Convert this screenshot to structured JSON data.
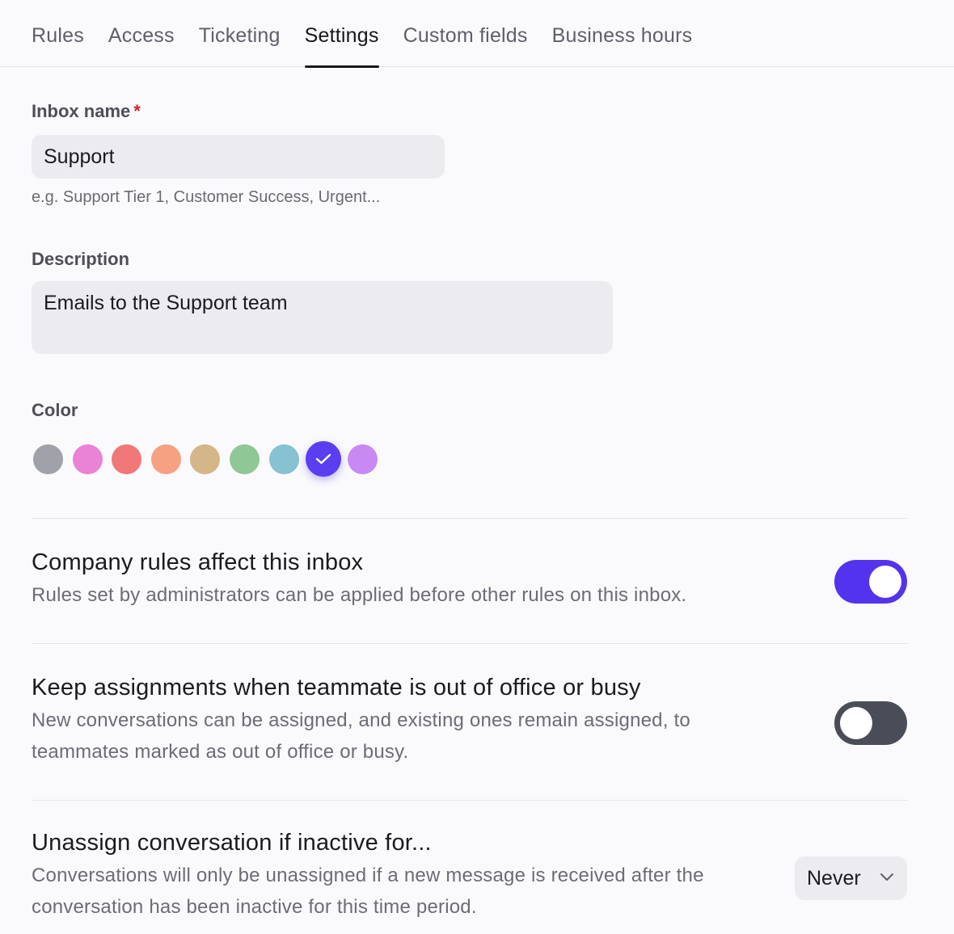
{
  "tabs": [
    {
      "label": "Rules",
      "active": false
    },
    {
      "label": "Access",
      "active": false
    },
    {
      "label": "Ticketing",
      "active": false
    },
    {
      "label": "Settings",
      "active": true
    },
    {
      "label": "Custom fields",
      "active": false
    },
    {
      "label": "Business hours",
      "active": false
    }
  ],
  "inbox_name": {
    "label": "Inbox name",
    "required_marker": "*",
    "value": "Support",
    "hint": "e.g. Support Tier 1, Customer Success, Urgent..."
  },
  "description": {
    "label": "Description",
    "value": "Emails to the Support team"
  },
  "color": {
    "label": "Color",
    "swatches": [
      "#a1a1aa",
      "#ea82d6",
      "#f07878",
      "#f6a282",
      "#d4b688",
      "#8fc796",
      "#86c2d1",
      "#5a3ef0",
      "#c88af2"
    ],
    "selected_index": 7,
    "check_icon": "check-icon"
  },
  "settings": {
    "company_rules": {
      "title": "Company rules affect this inbox",
      "description": "Rules set by administrators can be applied before other rules on this inbox.",
      "enabled": true
    },
    "keep_assignments": {
      "title": "Keep assignments when teammate is out of office or busy",
      "description": "New conversations can be assigned, and existing ones remain assigned, to teammates marked as out of office or busy.",
      "enabled": false
    },
    "unassign_inactive": {
      "title": "Unassign conversation if inactive for...",
      "description": "Conversations will only be unassigned if a new message is received after the conversation has been inactive for this time period.",
      "selected_value": "Never",
      "dropdown_icon": "chevron-down-icon"
    }
  },
  "colors": {
    "accent": "#5333ed",
    "toggle_off": "#4a4d57",
    "required": "#d4202c",
    "input_bg": "#ececf0"
  }
}
